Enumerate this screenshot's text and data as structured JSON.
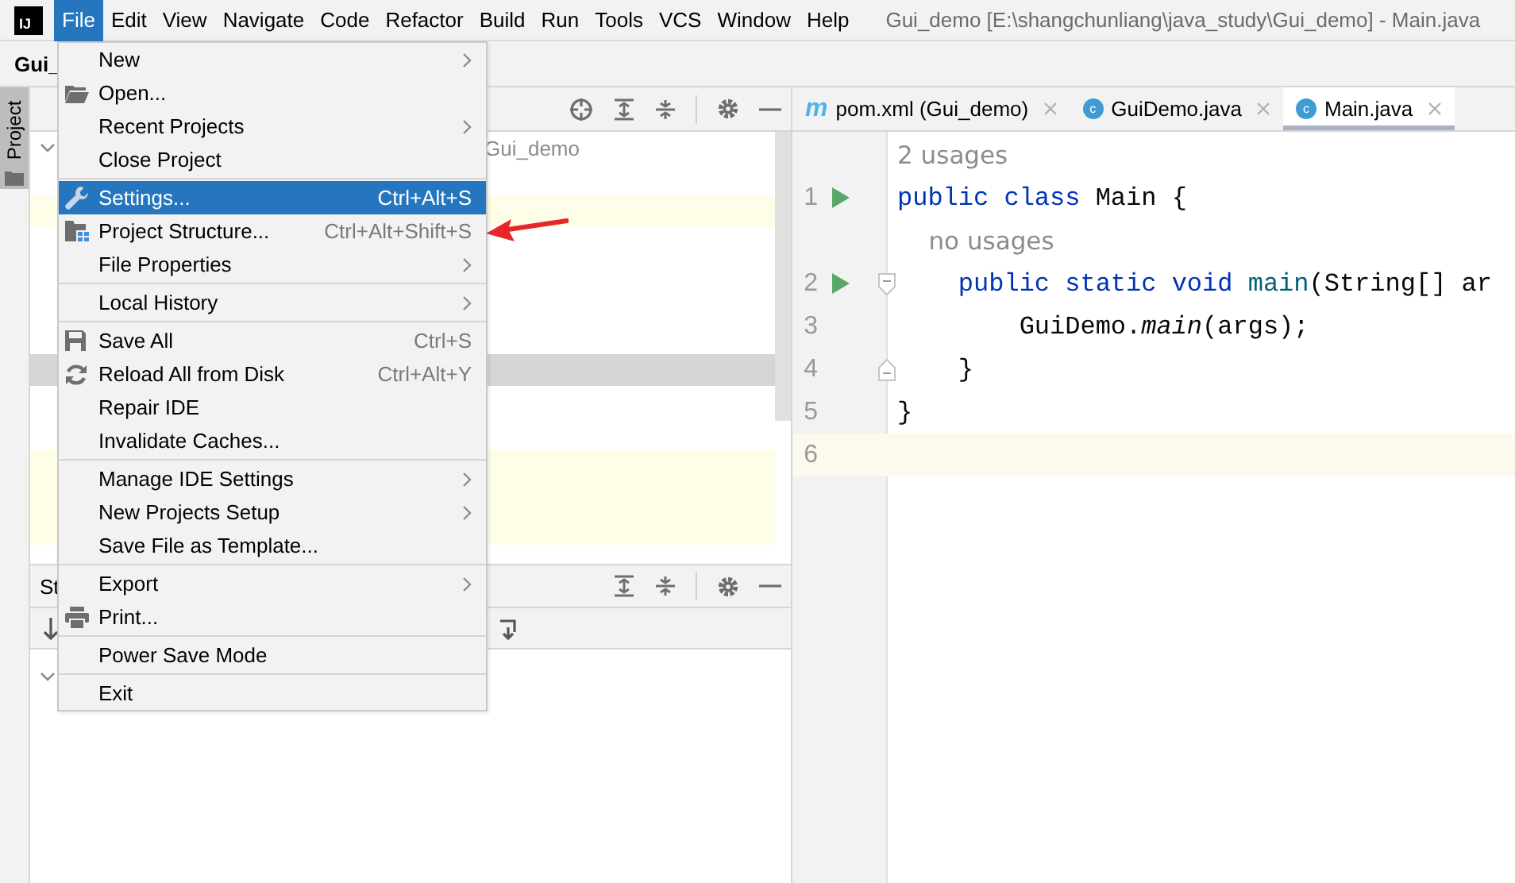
{
  "logo": "IJ",
  "menubar": [
    {
      "label": "File",
      "selected": true
    },
    {
      "label": "Edit",
      "selected": false
    },
    {
      "label": "View",
      "selected": false
    },
    {
      "label": "Navigate",
      "selected": false
    },
    {
      "label": "Code",
      "selected": false
    },
    {
      "label": "Refactor",
      "selected": false
    },
    {
      "label": "Build",
      "selected": false
    },
    {
      "label": "Run",
      "selected": false
    },
    {
      "label": "Tools",
      "selected": false
    },
    {
      "label": "VCS",
      "selected": false
    },
    {
      "label": "Window",
      "selected": false
    },
    {
      "label": "Help",
      "selected": false
    }
  ],
  "window": {
    "title": "Gui_demo [E:\\shangchunliang\\java_study\\Gui_demo] - Main.java"
  },
  "breadcrumb": "Gui_",
  "side_tab": {
    "label": "Project",
    "selected": true
  },
  "project_panel": {
    "tree": [
      {
        "label": "Gui_demo",
        "expanded": true,
        "selected": false,
        "highlighted": false
      },
      {
        "selected": false,
        "highlighted": false
      },
      {
        "selected": false,
        "highlighted": true
      },
      {
        "selected": false,
        "highlighted": false
      },
      {
        "selected": false,
        "highlighted": false
      },
      {
        "selected": false,
        "highlighted": false
      },
      {
        "selected": false,
        "highlighted": false
      },
      {
        "selected": true,
        "highlighted": false
      },
      {
        "selected": false,
        "highlighted": false
      },
      {
        "selected": false,
        "highlighted": false
      },
      {
        "selected": false,
        "highlighted": true
      },
      {
        "selected": false,
        "highlighted": true
      },
      {
        "selected": false,
        "highlighted": true
      }
    ]
  },
  "bottom_panel": {
    "title": "St",
    "tree": [
      {
        "expanded": true
      }
    ]
  },
  "file_menu": {
    "groups": [
      [
        {
          "label": "New",
          "kind": "plain",
          "submenu": true,
          "selected": false
        },
        {
          "label": "Open...",
          "kind": "open",
          "submenu": false,
          "selected": false
        },
        {
          "label": "Recent Projects",
          "kind": "plain",
          "submenu": true,
          "selected": false
        },
        {
          "label": "Close Project",
          "kind": "plain",
          "submenu": false,
          "selected": false
        }
      ],
      [
        {
          "label": "Settings...",
          "kind": "settings",
          "shortcut": "Ctrl+Alt+S",
          "submenu": false,
          "selected": true
        },
        {
          "label": "Project Structure...",
          "kind": "structure",
          "shortcut": "Ctrl+Alt+Shift+S",
          "submenu": false,
          "selected": false
        },
        {
          "label": "File Properties",
          "kind": "plain",
          "submenu": true,
          "selected": false
        }
      ],
      [
        {
          "label": "Local History",
          "kind": "plain",
          "submenu": true,
          "selected": false
        }
      ],
      [
        {
          "label": "Save All",
          "kind": "save",
          "shortcut": "Ctrl+S",
          "submenu": false,
          "selected": false
        },
        {
          "label": "Reload All from Disk",
          "kind": "reload",
          "shortcut": "Ctrl+Alt+Y",
          "submenu": false,
          "selected": false
        },
        {
          "label": "Repair IDE",
          "kind": "plain",
          "submenu": false,
          "selected": false
        },
        {
          "label": "Invalidate Caches...",
          "kind": "plain",
          "submenu": false,
          "selected": false
        }
      ],
      [
        {
          "label": "Manage IDE Settings",
          "kind": "plain",
          "submenu": true,
          "selected": false
        },
        {
          "label": "New Projects Setup",
          "kind": "plain",
          "submenu": true,
          "selected": false
        },
        {
          "label": "Save File as Template...",
          "kind": "plain",
          "submenu": false,
          "selected": false
        }
      ],
      [
        {
          "label": "Export",
          "kind": "plain",
          "submenu": true,
          "selected": false
        },
        {
          "label": "Print...",
          "kind": "print",
          "submenu": false,
          "selected": false
        }
      ],
      [
        {
          "label": "Power Save Mode",
          "kind": "plain",
          "submenu": false,
          "selected": false
        }
      ],
      [
        {
          "label": "Exit",
          "kind": "plain",
          "submenu": false,
          "selected": false
        }
      ]
    ]
  },
  "editor": {
    "tabs": [
      {
        "label": "pom.xml (Gui_demo)",
        "kind": "maven",
        "icon_letter": "m",
        "selected": false
      },
      {
        "label": "GuiDemo.java",
        "kind": "class",
        "icon_letter": "c",
        "selected": false
      },
      {
        "label": "Main.java",
        "kind": "class",
        "icon_letter": "c",
        "selected": true
      }
    ],
    "lines": [
      {
        "hint": "2 usages"
      },
      {
        "number": "1",
        "run": true,
        "fold_start": false,
        "fold_end": false,
        "current": false,
        "tokens": [
          {
            "text": "public class ",
            "kind": "keyword"
          },
          {
            "text": "Main {",
            "kind": "plain"
          }
        ]
      },
      {
        "hint": "    no usages"
      },
      {
        "number": "2",
        "run": true,
        "fold_start": true,
        "fold_end": false,
        "current": false,
        "tokens": [
          {
            "text": "    public static void ",
            "kind": "keyword"
          },
          {
            "text": "main",
            "kind": "method"
          },
          {
            "text": "(String[] ar",
            "kind": "plain"
          }
        ]
      },
      {
        "number": "3",
        "run": false,
        "fold_start": false,
        "fold_end": false,
        "current": false,
        "tokens": [
          {
            "text": "        GuiDemo.",
            "kind": "plain"
          },
          {
            "text": "main",
            "kind": "static-call"
          },
          {
            "text": "(args);",
            "kind": "plain"
          }
        ]
      },
      {
        "number": "4",
        "run": false,
        "fold_start": false,
        "fold_end": true,
        "current": false,
        "tokens": [
          {
            "text": "    }",
            "kind": "plain"
          }
        ]
      },
      {
        "number": "5",
        "run": false,
        "fold_start": false,
        "fold_end": false,
        "current": false,
        "tokens": [
          {
            "text": "}",
            "kind": "plain"
          }
        ]
      },
      {
        "number": "6",
        "run": false,
        "fold_start": false,
        "fold_end": false,
        "current": true
      }
    ]
  }
}
